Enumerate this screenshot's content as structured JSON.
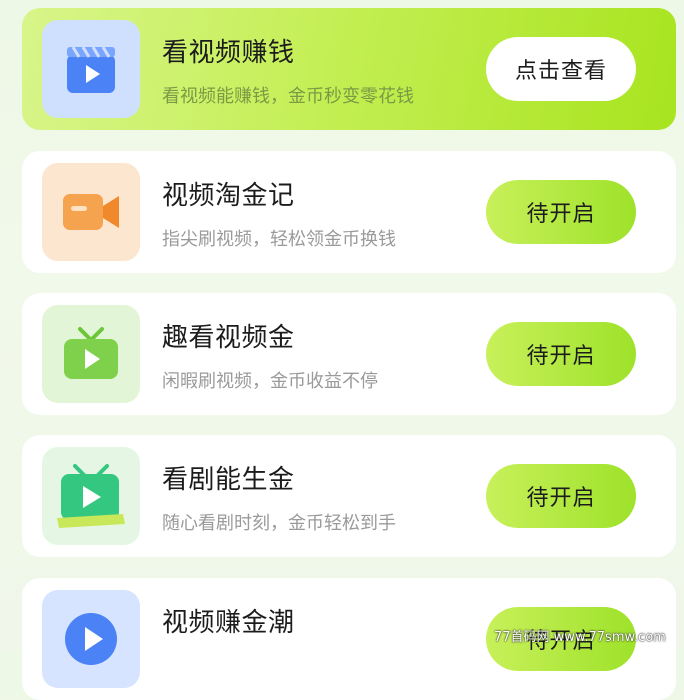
{
  "tasks": [
    {
      "title": "看视频赚钱",
      "subtitle": "看视频能赚钱，金币秒变零花钱",
      "button": "点击查看",
      "icon": "video-clapper-icon",
      "tile_color": "#cfe0ff",
      "icon_color": "#4b82f5"
    },
    {
      "title": "视频淘金记",
      "subtitle": "指尖刷视频，轻松领金币换钱",
      "button": "待开启",
      "icon": "video-camera-icon",
      "tile_color": "#fde6cf",
      "icon_color": "#f5a34f"
    },
    {
      "title": "趣看视频金",
      "subtitle": "闲暇刷视频，金币收益不停",
      "button": "待开启",
      "icon": "tv-play-icon",
      "tile_color": "#e2f5d6",
      "icon_color": "#7fd04a"
    },
    {
      "title": "看剧能生金",
      "subtitle": "随心看剧时刻，金币轻松到手",
      "button": "待开启",
      "icon": "tv-drama-icon",
      "tile_color": "#e6f6e4",
      "icon_color": "#34c77f"
    },
    {
      "title": "视频赚金潮",
      "subtitle": "",
      "button": "待开启",
      "icon": "play-circle-icon",
      "tile_color": "#d6e4ff",
      "icon_color": "#4b82f5"
    }
  ],
  "watermark": "77首码网 www.77smw.com"
}
